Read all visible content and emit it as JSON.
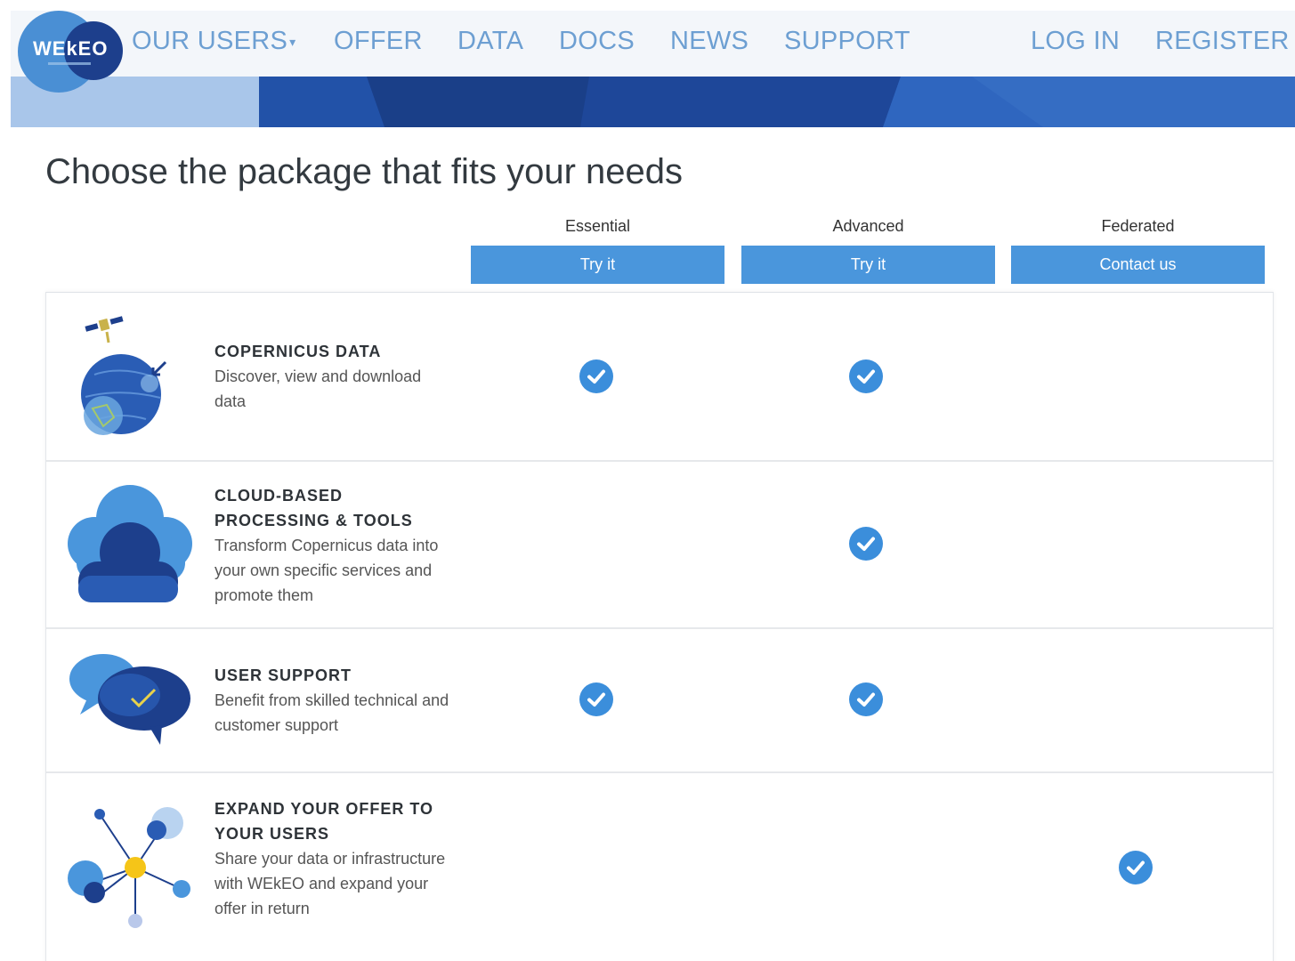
{
  "header": {
    "logo_text": "WEkEO",
    "nav": {
      "our_users": "OUR USERS",
      "offer": "OFFER",
      "data": "DATA",
      "docs": "DOCS",
      "news": "NEWS",
      "support": "SUPPORT",
      "login": "LOG IN",
      "register": "REGISTER"
    }
  },
  "page": {
    "title": "Choose the package that fits your needs"
  },
  "packages": [
    {
      "name": "Essential",
      "button": "Try it"
    },
    {
      "name": "Advanced",
      "button": "Try it"
    },
    {
      "name": "Federated",
      "button": "Contact us"
    }
  ],
  "features": [
    {
      "heading": "COPERNICUS DATA",
      "description": "Discover, view and download data",
      "icon": "satellite-globe-icon",
      "included": [
        true,
        true,
        false
      ]
    },
    {
      "heading": "CLOUD-BASED PROCESSING & TOOLS",
      "description": "Transform Copernicus data into your own specific services and promote them",
      "icon": "cloud-icon",
      "included": [
        false,
        true,
        false
      ]
    },
    {
      "heading": "USER SUPPORT",
      "description": "Benefit from skilled technical and customer support",
      "icon": "chat-bubbles-icon",
      "included": [
        true,
        true,
        false
      ]
    },
    {
      "heading": "EXPAND YOUR OFFER TO YOUR USERS",
      "description": "Share your data or infrastructure with WEkEO and expand your offer in return",
      "icon": "network-hub-icon",
      "included": [
        false,
        false,
        true
      ]
    }
  ],
  "colors": {
    "accent": "#4a96dc",
    "check": "#3b8edb",
    "nav_text": "#6d9fd2",
    "brand_dark": "#1d3f8c"
  }
}
